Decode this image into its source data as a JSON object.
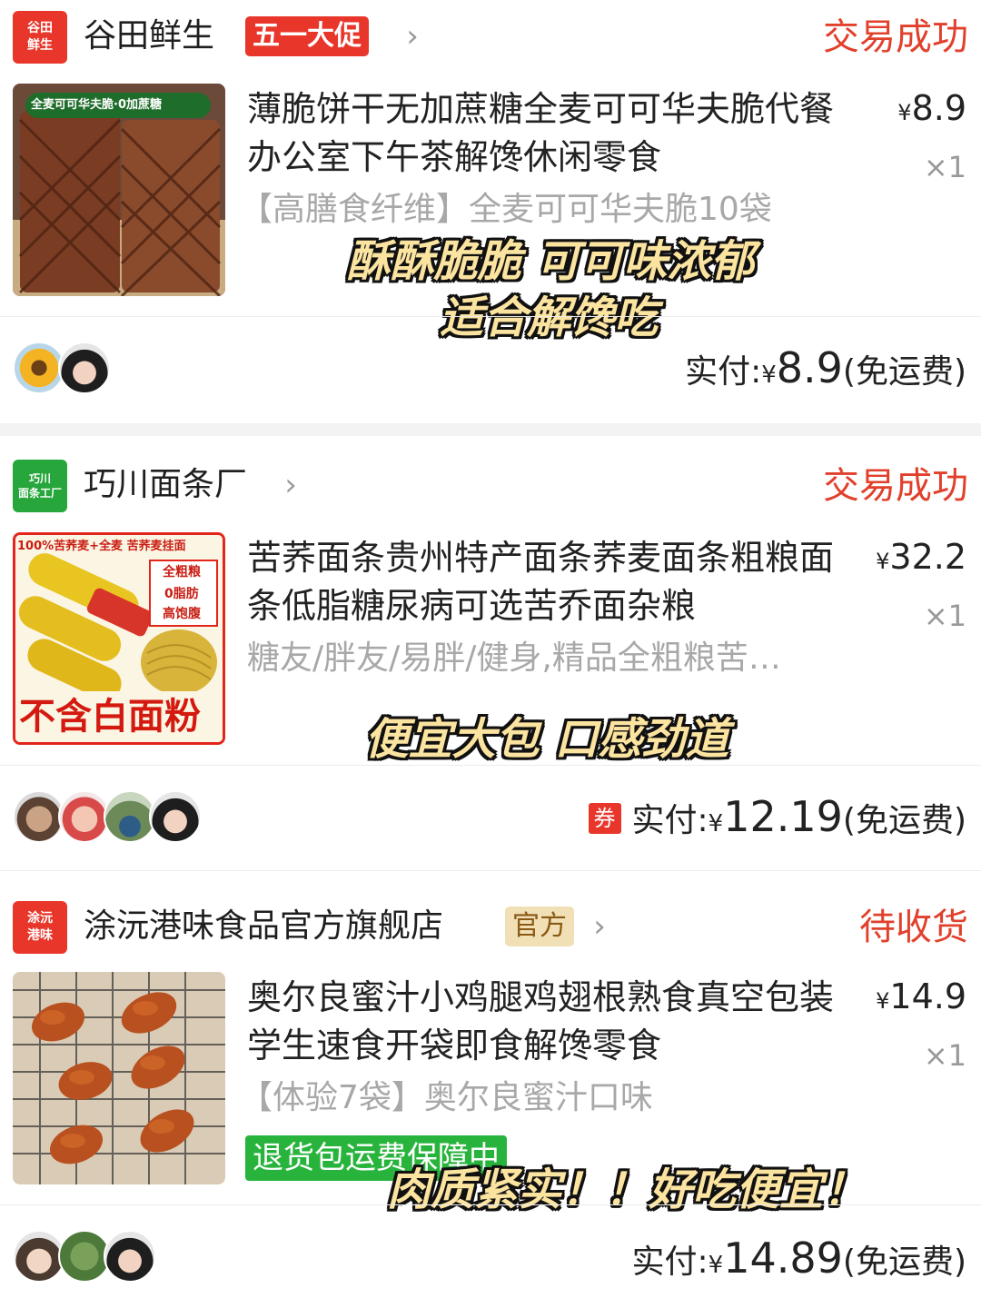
{
  "orders": [
    {
      "shop_logo": "谷田\n鲜生",
      "shop_logo_color": "#e8362b",
      "shop_name": "谷田鲜生",
      "badge": "五一大促",
      "status": "交易成功",
      "title": "薄脆饼干无加蔗糖全麦可可华夫脆代餐办公室下午茶解馋休闲零食",
      "price_symbol": "¥",
      "price": "8.9",
      "qty": "×1",
      "spec": "【高膳食纤维】全麦可可华夫脆10袋",
      "image_text": "全麦可可华夫脆·0加蔗糖",
      "caption_line1": "酥酥脆脆 可可味浓郁",
      "caption_line2": "适合解馋吃",
      "paid_label": "实付:",
      "paid_symbol": "¥",
      "paid_amount": "8.9",
      "shipping": "(免运费)"
    },
    {
      "shop_logo": "巧川\n面条工厂",
      "shop_logo_color": "#26a63b",
      "shop_name": "巧川面条厂",
      "status": "交易成功",
      "title": "苦荞面条贵州特产面条荞麦面条粗粮面条低脂糖尿病可选苦乔面杂粮",
      "price_symbol": "¥",
      "price": "32.2",
      "qty": "×1",
      "spec": "糖友/胖友/易胖/健身,精品全粗粮苦…",
      "image_text_top": "100%苦荞麦+全麦 苦荞麦挂面",
      "image_tags": [
        "全粗粮",
        "0脂肪",
        "高饱腹"
      ],
      "image_text_bottom": "不含白面粉",
      "caption_line1": "便宜大包 口感劲道",
      "coupon": "券",
      "paid_label": "实付:",
      "paid_symbol": "¥",
      "paid_amount": "12.19",
      "shipping": "(免运费)"
    },
    {
      "shop_logo": "涂沅\n港味",
      "shop_logo_color": "#e8362b",
      "shop_name": "涂沅港味食品官方旗舰店",
      "badge": "官方",
      "status": "待收货",
      "title": "奥尔良蜜汁小鸡腿鸡翅根熟食真空包装学生速食开袋即食解馋零食",
      "price_symbol": "¥",
      "price": "14.9",
      "qty": "×1",
      "spec": "【体验7袋】奥尔良蜜汁口味",
      "returns_tag": "退货包运费保障中",
      "caption_line1": "肉质紧实！！好吃便宜！",
      "paid_label": "实付:",
      "paid_symbol": "¥",
      "paid_amount": "14.89",
      "shipping": "(免运费)"
    }
  ],
  "icons": {
    "chevron": "chevron-right-icon"
  }
}
